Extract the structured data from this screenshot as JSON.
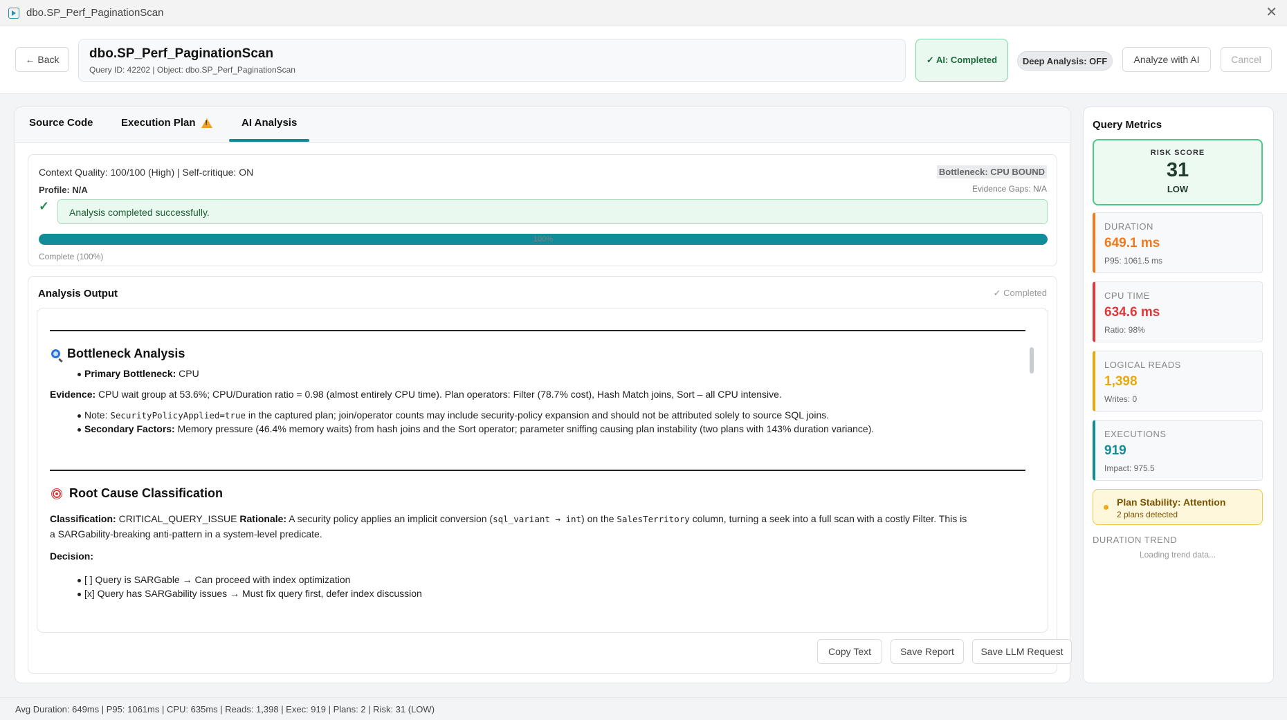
{
  "window": {
    "title": "dbo.SP_Perf_PaginationScan"
  },
  "header": {
    "back_label": "← Back",
    "title": "dbo.SP_Perf_PaginationScan",
    "subtitle": "Query ID: 42202 | Object: dbo.SP_Perf_PaginationScan",
    "ai_status": "✓ AI: Completed",
    "deep_analysis": "Deep Analysis: OFF",
    "analyze_label": "Analyze with AI",
    "cancel_label": "Cancel"
  },
  "tabs": [
    {
      "label": "Source Code"
    },
    {
      "label": "Execution Plan",
      "icon": "warning-icon"
    },
    {
      "label": "AI Analysis",
      "active": true
    }
  ],
  "status": {
    "context": "Context Quality: 100/100 (High) | Self-critique: ON",
    "profile": "Profile: N/A",
    "bottleneck": "Bottleneck: CPU BOUND",
    "evidence_gaps": "Evidence Gaps: N/A",
    "check": "✓",
    "message": "Analysis completed successfully.",
    "progress": 100,
    "progress_text": "100%",
    "progress_label": "Complete (100%)"
  },
  "output": {
    "title": "Analysis Output",
    "status": "✓ Completed",
    "bottleneck_heading": "Bottleneck Analysis",
    "primary_label": "Primary Bottleneck:",
    "primary_value": " CPU",
    "evidence_label": "Evidence:",
    "evidence_text": " CPU wait group at 53.6%; CPU/Duration ratio = 0.98 (almost entirely CPU time). Plan operators: Filter (78.7% cost), Hash Match joins, Sort – all CPU intensive.",
    "note_prefix": "Note: ",
    "note_code": "SecurityPolicyApplied=true",
    "note_rest": " in the captured plan; join/operator counts may include security-policy expansion and should not be attributed solely to source SQL joins.",
    "secondary_label": "Secondary Factors:",
    "secondary_text": " Memory pressure (46.4% memory waits) from hash joins and the Sort operator; parameter sniffing causing plan instability (two plans with 143% duration variance).",
    "root_heading": "Root Cause Classification",
    "class_label": "Classification:",
    "class_value": " CRITICAL_QUERY_ISSUE ",
    "rationale_label": "Rationale:",
    "rationale_a": " A security policy applies an implicit conversion (",
    "rationale_code1": "sql_variant → int",
    "rationale_b": ") on the ",
    "rationale_code2": "SalesTerritory",
    "rationale_c": " column, turning a seek into a full scan with a costly Filter. This is",
    "rationale_line2": "a SARGability-breaking anti-pattern in a system-level predicate.",
    "decision_label": "Decision:",
    "decision_items": [
      "[ ] Query is SARGable → Can proceed with index optimization",
      "[x] Query has SARGability issues → Must fix query first, defer index discussion"
    ],
    "copy_label": "Copy Text",
    "save_label": "Save Report",
    "llm_label": "Save LLM Request"
  },
  "metrics": {
    "title": "Query Metrics",
    "risk_label": "RISK SCORE",
    "risk_value": "31",
    "risk_level": "LOW",
    "cards": [
      {
        "label": "DURATION",
        "value": "649.1 ms",
        "sub": "P95: 1061.5 ms",
        "color": "#f07a1c"
      },
      {
        "label": "CPU TIME",
        "value": "634.6 ms",
        "sub": "Ratio: 98%",
        "color": "#e0393b"
      },
      {
        "label": "LOGICAL READS",
        "value": "1,398",
        "sub": "Writes: 0",
        "color": "#e8a80e"
      },
      {
        "label": "EXECUTIONS",
        "value": "919",
        "sub": "Impact: 975.5",
        "color": "#128c99"
      }
    ],
    "stability_title": "Plan Stability: Attention",
    "stability_sub": "2 plans detected",
    "trend_label": "DURATION TREND",
    "trend_loading": "Loading trend data..."
  },
  "statusbar": {
    "text": "Avg Duration: 649ms | P95: 1061ms | CPU: 635ms | Reads: 1,398 | Exec: 919 | Plans: 2 | Risk: 31 (LOW)"
  }
}
